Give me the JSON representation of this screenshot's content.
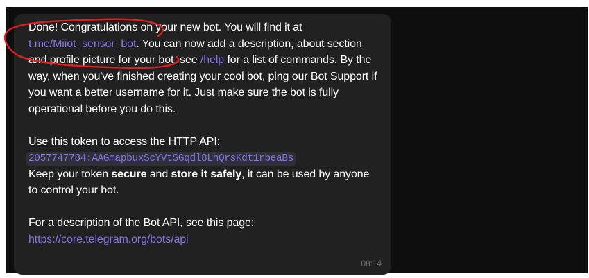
{
  "message": {
    "line1_prefix": "Done! Congratulations on your new bot. You will find it at ",
    "bot_link": "t.me/Miiot_sensor_bot",
    "line1_mid": ". You can now add a description, about section and profile picture for your bot, see ",
    "help_command": "/help",
    "line1_suffix": " for a list of commands. By the way, when you've finished creating your cool bot, ping our Bot Support if you want a better username for it. Just make sure the bot is fully operational before you do this.",
    "token_intro": "Use this token to access the HTTP API:",
    "token": "2057747784:AAGmapbuxScYVtSGqdl8LhQrsKdt1rbeaBs",
    "keep_prefix": "Keep your token ",
    "keep_secure": "secure",
    "keep_and": " and ",
    "keep_store": "store it safely",
    "keep_suffix": ", it can be used by anyone to control your bot.",
    "api_intro": "For a description of the Bot API, see this page:",
    "api_link": "https://core.telegram.org/bots/api",
    "time": "08:14"
  },
  "colors": {
    "bubble": "#212121",
    "background": "#0e0e0e",
    "link": "#8774e1",
    "annotation": "#e0201d"
  },
  "annotation": {
    "shape": "hand-drawn-circle"
  }
}
